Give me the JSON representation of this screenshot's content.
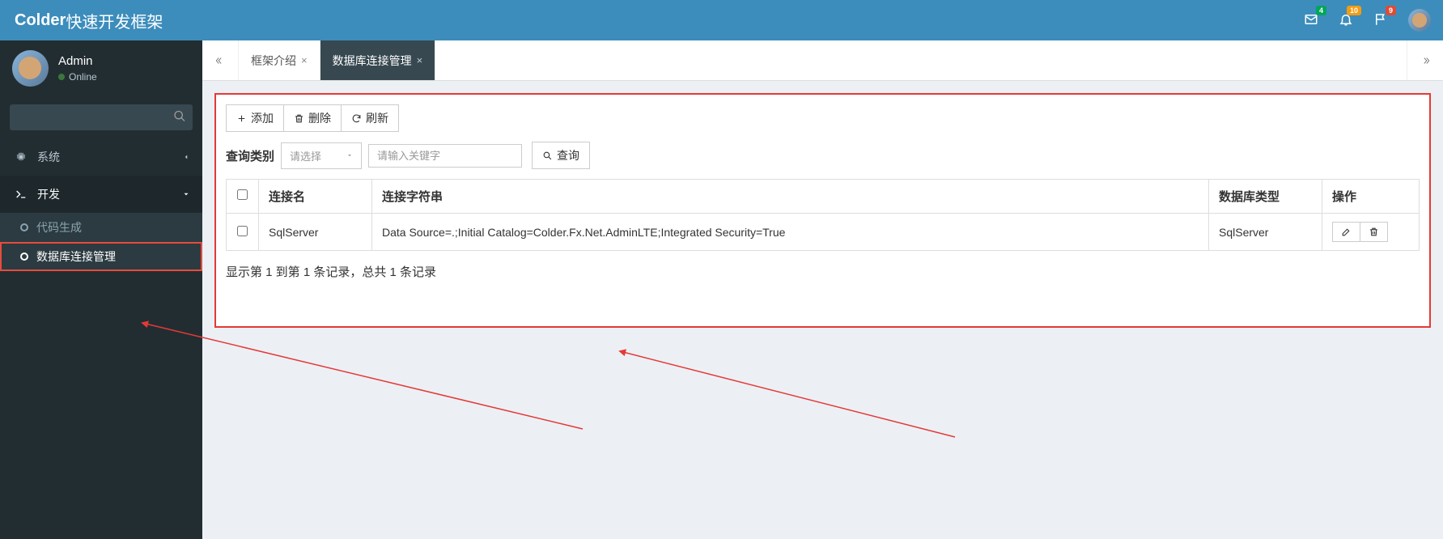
{
  "header": {
    "brand_strong": "Colder",
    "brand_rest": "快速开发框架",
    "badges": {
      "mail": "4",
      "bell": "10",
      "flag": "9"
    }
  },
  "sidebar": {
    "user": {
      "name": "Admin",
      "status": "Online"
    },
    "search_placeholder": "",
    "items": [
      {
        "icon": "gear",
        "label": "系统",
        "expanded": false
      },
      {
        "icon": "terminal",
        "label": "开发",
        "expanded": true,
        "children": [
          {
            "label": "代码生成",
            "active": false
          },
          {
            "label": "数据库连接管理",
            "active": true
          }
        ]
      }
    ]
  },
  "tabs": [
    {
      "label": "框架介绍",
      "active": false
    },
    {
      "label": "数据库连接管理",
      "active": true
    }
  ],
  "toolbar": {
    "add": "添加",
    "delete": "删除",
    "refresh": "刷新"
  },
  "filter": {
    "label": "查询类别",
    "select_placeholder": "请选择",
    "keyword_placeholder": "请输入关键字",
    "query_btn": "查询"
  },
  "table": {
    "headers": [
      "连接名",
      "连接字符串",
      "数据库类型",
      "操作"
    ],
    "rows": [
      {
        "name": "SqlServer",
        "connstr": "Data Source=.;Initial Catalog=Colder.Fx.Net.AdminLTE;Integrated Security=True",
        "dbtype": "SqlServer"
      }
    ]
  },
  "pagination_info": "显示第 1 到第 1 条记录，总共 1 条记录"
}
